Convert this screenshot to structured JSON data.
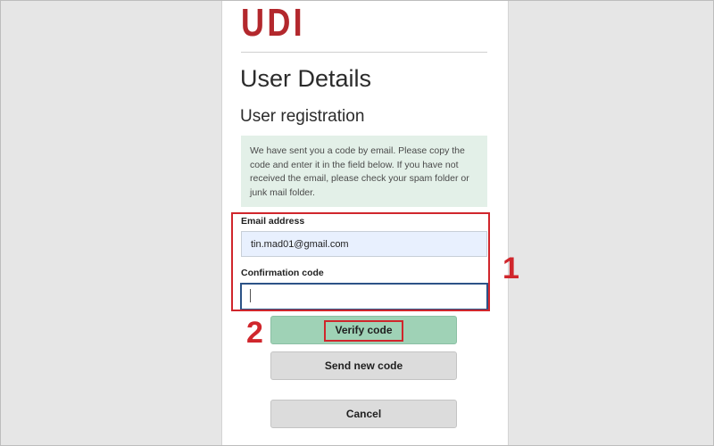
{
  "brand": {
    "logo_text": "UDI",
    "logo_color": "#b3282d"
  },
  "page": {
    "title": "User Details",
    "subtitle": "User registration",
    "info_message": "We have sent you a code by email. Please copy the code and enter it in the field below. If you have not received the email, please check your spam folder or junk mail folder."
  },
  "form": {
    "email": {
      "label": "Email address",
      "value": "tin.mad01@gmail.com"
    },
    "confirmation_code": {
      "label": "Confirmation code",
      "value": ""
    }
  },
  "buttons": {
    "verify_label": "Verify code",
    "send_new_label": "Send new code",
    "cancel_label": "Cancel"
  },
  "annotations": {
    "marker_1": "1",
    "marker_2": "2",
    "highlight_color": "#d0262c"
  },
  "colors": {
    "verify_button": "#9fd2b6",
    "secondary_button": "#dcdcdc",
    "info_box_background": "#e3f0e8",
    "focused_input_border": "#2c5387"
  }
}
